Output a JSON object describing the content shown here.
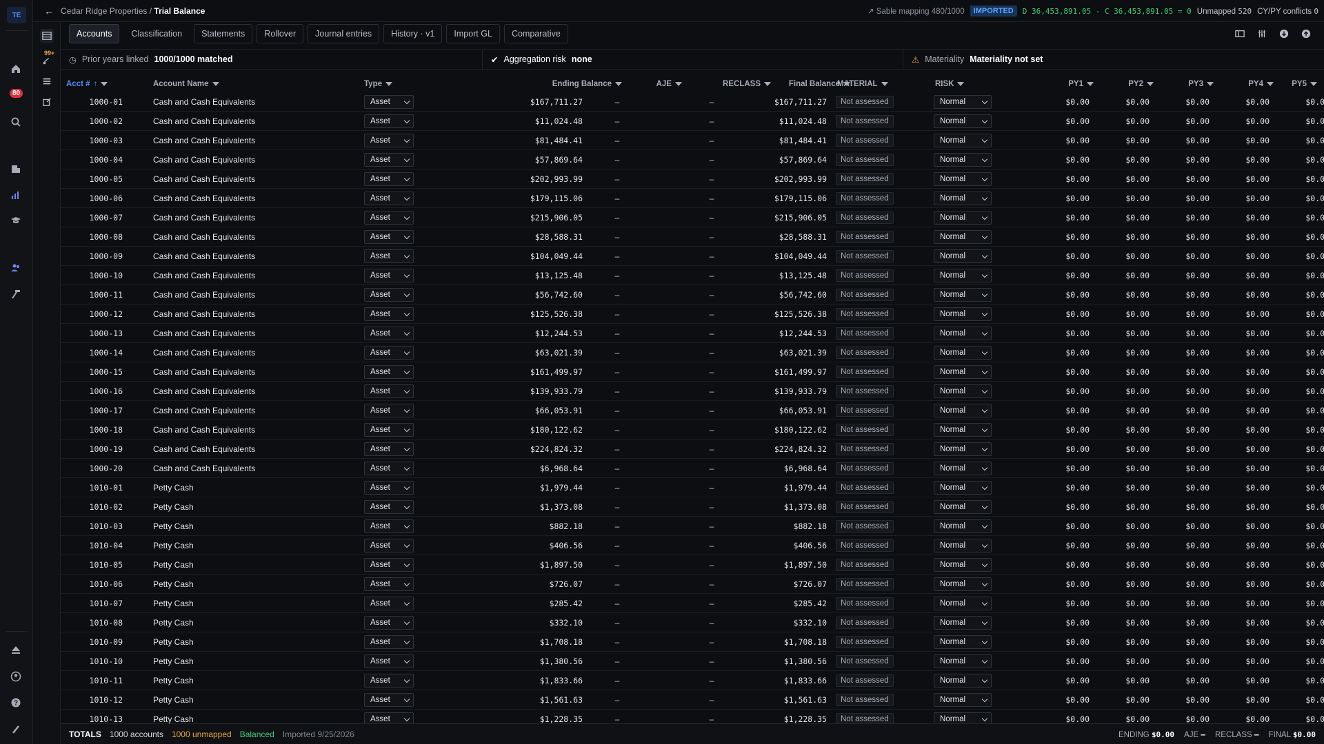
{
  "app": {
    "logo": "TE",
    "notif_count": "80",
    "inbox_count": "99+"
  },
  "breadcrumb": {
    "client": "Cedar Ridge Properties /",
    "page": "Trial Balance"
  },
  "status": {
    "sable": "Sable mapping 480/1000",
    "imported": "IMPORTED",
    "dc": "D 36,453,891.05 - C 36,453,891.05 = 0",
    "unmapped_label": "Unmapped",
    "unmapped_count": "520",
    "conflicts_label": "CY/PY conflicts",
    "conflicts_count": "0"
  },
  "tabs": [
    "Accounts",
    "Classification",
    "Statements",
    "Rollover",
    "Journal entries",
    "History · v1",
    "Import GL",
    "Comparative"
  ],
  "info": {
    "prior_label": "Prior years linked",
    "prior_value": "1000/1000 matched",
    "agg_label": "Aggregation risk",
    "agg_value": "none",
    "mat_label": "Materiality",
    "mat_value": "Materiality not set"
  },
  "columns": {
    "acct": "Acct #",
    "name": "Account Name",
    "type": "Type",
    "ending": "Ending Balance",
    "aje": "AJE",
    "reclass": "RECLASS",
    "final": "Final Balance",
    "material": "MATERIAL",
    "risk": "RISK",
    "py1": "PY1",
    "py2": "PY2",
    "py3": "PY3",
    "py4": "PY4",
    "py5": "PY5"
  },
  "row_defaults": {
    "type": "Asset",
    "aje": "–",
    "reclass": "–",
    "material": "Not assessed",
    "risk": "Normal",
    "py": "$0.00"
  },
  "rows": [
    {
      "acct": "1000-01",
      "name": "Cash and Cash Equivalents",
      "ending": "$167,711.27",
      "final": "$167,711.27"
    },
    {
      "acct": "1000-02",
      "name": "Cash and Cash Equivalents",
      "ending": "$11,024.48",
      "final": "$11,024.48"
    },
    {
      "acct": "1000-03",
      "name": "Cash and Cash Equivalents",
      "ending": "$81,484.41",
      "final": "$81,484.41"
    },
    {
      "acct": "1000-04",
      "name": "Cash and Cash Equivalents",
      "ending": "$57,869.64",
      "final": "$57,869.64"
    },
    {
      "acct": "1000-05",
      "name": "Cash and Cash Equivalents",
      "ending": "$202,993.99",
      "final": "$202,993.99"
    },
    {
      "acct": "1000-06",
      "name": "Cash and Cash Equivalents",
      "ending": "$179,115.06",
      "final": "$179,115.06"
    },
    {
      "acct": "1000-07",
      "name": "Cash and Cash Equivalents",
      "ending": "$215,906.05",
      "final": "$215,906.05"
    },
    {
      "acct": "1000-08",
      "name": "Cash and Cash Equivalents",
      "ending": "$28,588.31",
      "final": "$28,588.31"
    },
    {
      "acct": "1000-09",
      "name": "Cash and Cash Equivalents",
      "ending": "$104,049.44",
      "final": "$104,049.44"
    },
    {
      "acct": "1000-10",
      "name": "Cash and Cash Equivalents",
      "ending": "$13,125.48",
      "final": "$13,125.48"
    },
    {
      "acct": "1000-11",
      "name": "Cash and Cash Equivalents",
      "ending": "$56,742.60",
      "final": "$56,742.60"
    },
    {
      "acct": "1000-12",
      "name": "Cash and Cash Equivalents",
      "ending": "$125,526.38",
      "final": "$125,526.38"
    },
    {
      "acct": "1000-13",
      "name": "Cash and Cash Equivalents",
      "ending": "$12,244.53",
      "final": "$12,244.53"
    },
    {
      "acct": "1000-14",
      "name": "Cash and Cash Equivalents",
      "ending": "$63,021.39",
      "final": "$63,021.39"
    },
    {
      "acct": "1000-15",
      "name": "Cash and Cash Equivalents",
      "ending": "$161,499.97",
      "final": "$161,499.97"
    },
    {
      "acct": "1000-16",
      "name": "Cash and Cash Equivalents",
      "ending": "$139,933.79",
      "final": "$139,933.79"
    },
    {
      "acct": "1000-17",
      "name": "Cash and Cash Equivalents",
      "ending": "$66,053.91",
      "final": "$66,053.91"
    },
    {
      "acct": "1000-18",
      "name": "Cash and Cash Equivalents",
      "ending": "$180,122.62",
      "final": "$180,122.62"
    },
    {
      "acct": "1000-19",
      "name": "Cash and Cash Equivalents",
      "ending": "$224,824.32",
      "final": "$224,824.32"
    },
    {
      "acct": "1000-20",
      "name": "Cash and Cash Equivalents",
      "ending": "$6,968.64",
      "final": "$6,968.64"
    },
    {
      "acct": "1010-01",
      "name": "Petty Cash",
      "ending": "$1,979.44",
      "final": "$1,979.44"
    },
    {
      "acct": "1010-02",
      "name": "Petty Cash",
      "ending": "$1,373.08",
      "final": "$1,373.08"
    },
    {
      "acct": "1010-03",
      "name": "Petty Cash",
      "ending": "$882.18",
      "final": "$882.18"
    },
    {
      "acct": "1010-04",
      "name": "Petty Cash",
      "ending": "$406.56",
      "final": "$406.56"
    },
    {
      "acct": "1010-05",
      "name": "Petty Cash",
      "ending": "$1,897.50",
      "final": "$1,897.50"
    },
    {
      "acct": "1010-06",
      "name": "Petty Cash",
      "ending": "$726.07",
      "final": "$726.07"
    },
    {
      "acct": "1010-07",
      "name": "Petty Cash",
      "ending": "$285.42",
      "final": "$285.42"
    },
    {
      "acct": "1010-08",
      "name": "Petty Cash",
      "ending": "$332.10",
      "final": "$332.10"
    },
    {
      "acct": "1010-09",
      "name": "Petty Cash",
      "ending": "$1,708.18",
      "final": "$1,708.18"
    },
    {
      "acct": "1010-10",
      "name": "Petty Cash",
      "ending": "$1,380.56",
      "final": "$1,380.56"
    },
    {
      "acct": "1010-11",
      "name": "Petty Cash",
      "ending": "$1,833.66",
      "final": "$1,833.66"
    },
    {
      "acct": "1010-12",
      "name": "Petty Cash",
      "ending": "$1,561.63",
      "final": "$1,561.63"
    },
    {
      "acct": "1010-13",
      "name": "Petty Cash",
      "ending": "$1,228.35",
      "final": "$1,228.35"
    }
  ],
  "footer": {
    "totals": "TOTALS",
    "accounts": "1000 accounts",
    "unmapped": "1000 unmapped",
    "balanced": "Balanced",
    "imported": "Imported 9/25/2026",
    "ending_label": "ENDING",
    "ending_value": "$0.00",
    "aje_label": "AJE",
    "aje_value": "–",
    "reclass_label": "RECLASS",
    "reclass_value": "–",
    "final_label": "FINAL",
    "final_value": "$0.00"
  }
}
